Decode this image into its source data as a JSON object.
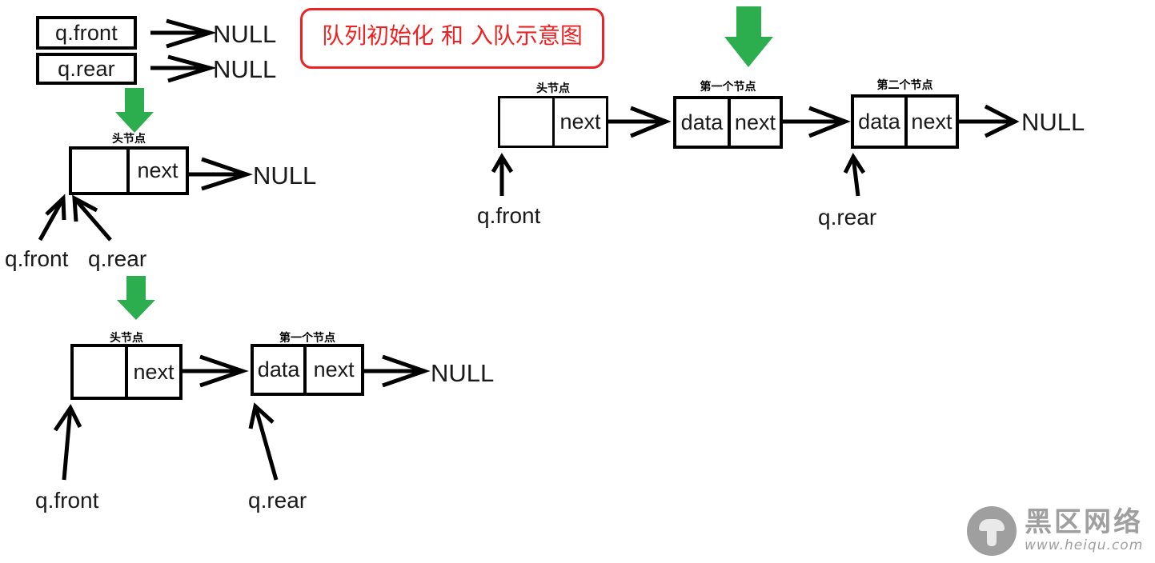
{
  "title": {
    "text": "队列初始化 和 入队示意图",
    "border_color": "#ee2222",
    "text_color": "#ee2222"
  },
  "colors": {
    "green_arrow": "#2DAE4E",
    "stroke": "#000000",
    "text": "#1a1a1a",
    "watermark": "#9a9a9a"
  },
  "stage1": {
    "front_box_label": "q.front",
    "rear_box_label": "q.rear",
    "front_target": "NULL",
    "rear_target": "NULL"
  },
  "stage2": {
    "caption": "头节点",
    "cell_data": "",
    "cell_next": "next",
    "null_label": "NULL",
    "pointer_front": "q.front",
    "pointer_rear": "q.rear"
  },
  "stage3": {
    "head_caption": "头节点",
    "head_cell_data": "",
    "head_cell_next": "next",
    "first_caption": "第一个节点",
    "first_cell_data": "data",
    "first_cell_next": "next",
    "null_label": "NULL",
    "pointer_front": "q.front",
    "pointer_rear": "q.rear"
  },
  "stage4": {
    "head_caption": "头节点",
    "head_cell_data": "",
    "head_cell_next": "next",
    "first_caption": "第一个节点",
    "first_cell_data": "data",
    "first_cell_next": "next",
    "second_caption": "第二个节点",
    "second_cell_data": "data",
    "second_cell_next": "next",
    "null_label": "NULL",
    "pointer_front": "q.front",
    "pointer_rear": "q.rear"
  },
  "watermark": {
    "cn": "黑区网络",
    "url": "www.heiqu.com"
  }
}
